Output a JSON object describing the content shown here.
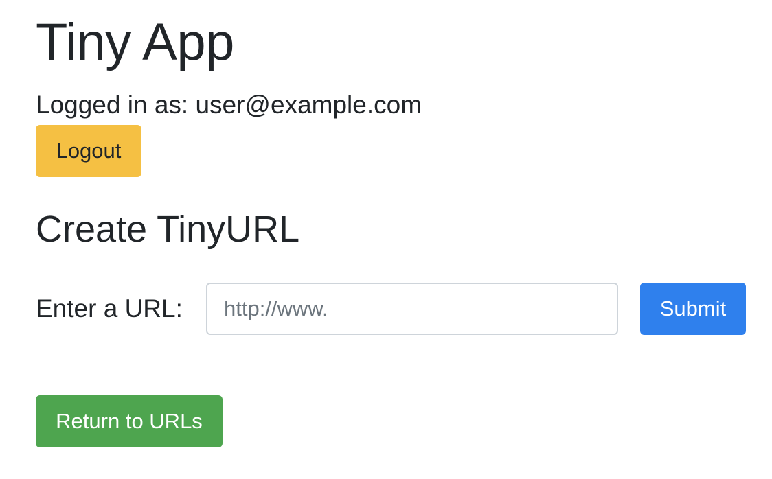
{
  "header": {
    "title": "Tiny App",
    "login_status": "Logged in as: user@example.com",
    "logout_label": "Logout"
  },
  "create_form": {
    "title": "Create TinyURL",
    "url_label": "Enter a URL:",
    "url_placeholder": "http://www.",
    "url_value": "",
    "submit_label": "Submit"
  },
  "footer": {
    "return_label": "Return to URLs"
  },
  "colors": {
    "logout_button": "#f5c043",
    "submit_button": "#2f80ed",
    "return_button": "#4ea54f",
    "text": "#212529"
  }
}
